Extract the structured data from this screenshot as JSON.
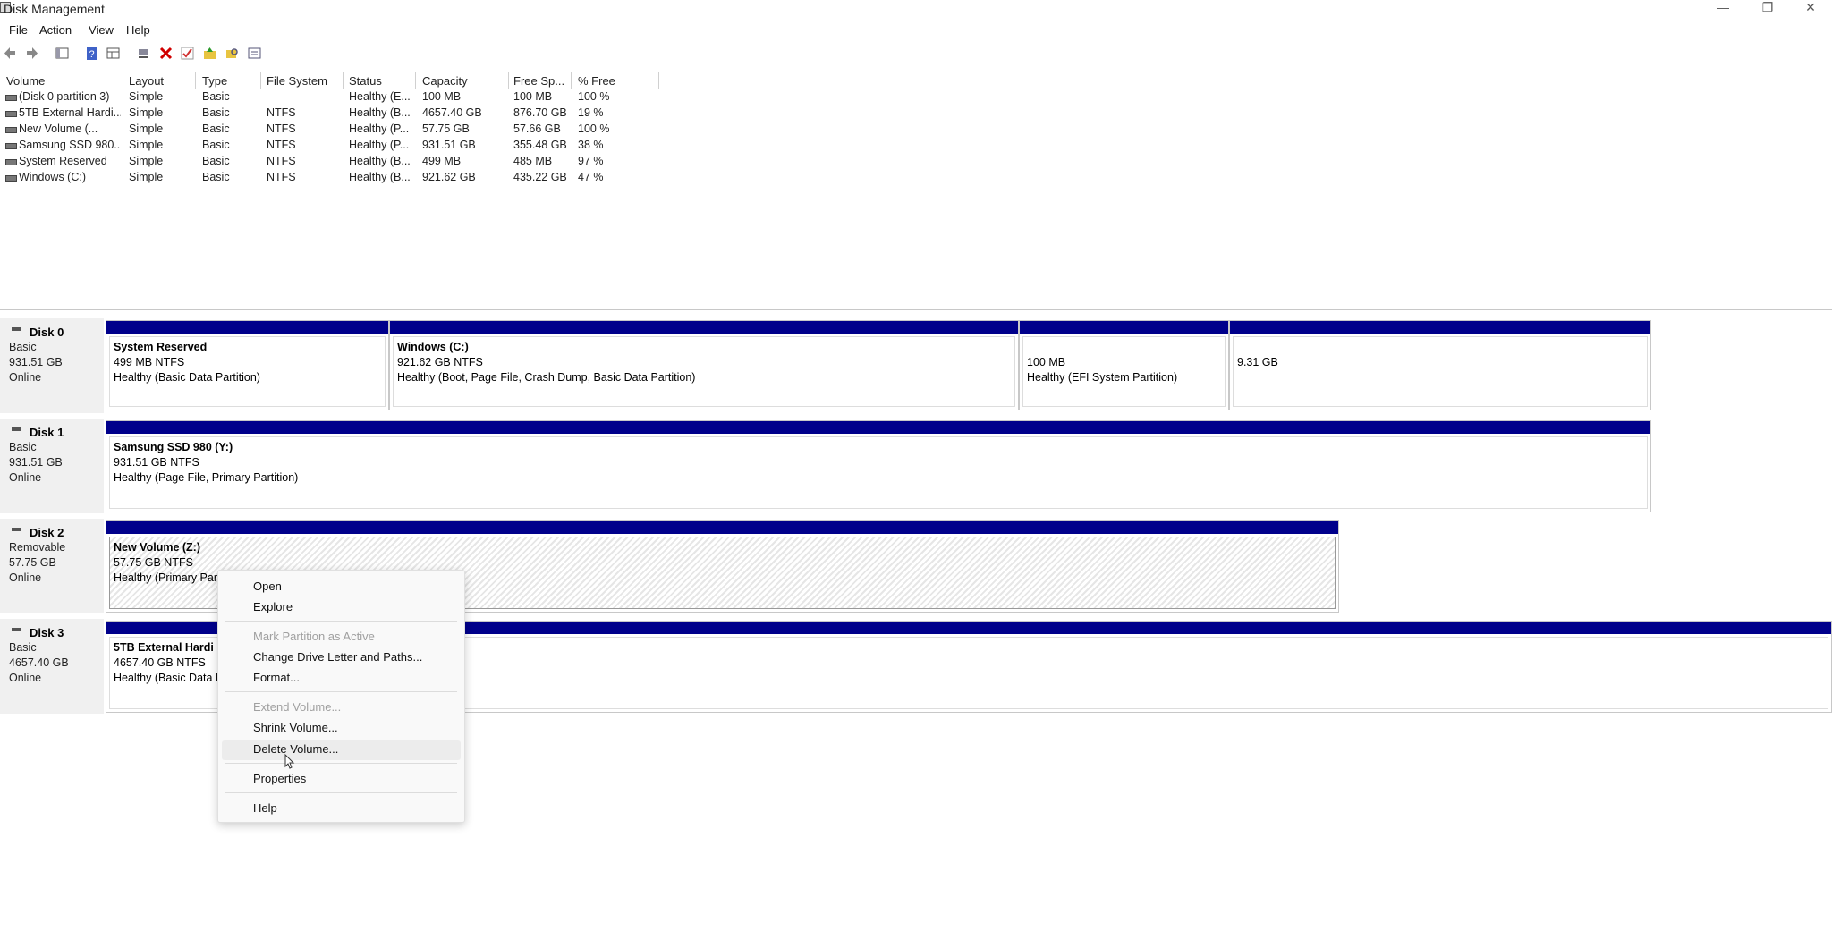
{
  "window": {
    "title": "Disk Management",
    "controls": [
      "—",
      "❐",
      "✕"
    ]
  },
  "menu": [
    "File",
    "Action",
    "View",
    "Help"
  ],
  "toolbar": {
    "icons": [
      "back-arrow-icon",
      "forward-arrow-icon",
      "console-tree-icon",
      "help-icon",
      "show-panel-icon",
      "connect-icon",
      "delete-icon",
      "checkmark-icon",
      "folder-up-icon",
      "folder-search-icon",
      "properties-list-icon"
    ],
    "delete_color": "#d00000"
  },
  "volume_table": {
    "headers": [
      "Volume",
      "Layout",
      "Type",
      "File System",
      "Status",
      "Capacity",
      "Free Sp...",
      "% Free"
    ],
    "rows": [
      {
        "volume": "(Disk 0 partition 3)",
        "layout": "Simple",
        "type": "Basic",
        "fs": "",
        "status": "Healthy (E...",
        "capacity": "100 MB",
        "free": "100 MB",
        "pct": "100 %"
      },
      {
        "volume": "5TB External Hardi...",
        "layout": "Simple",
        "type": "Basic",
        "fs": "NTFS",
        "status": "Healthy (B...",
        "capacity": "4657.40 GB",
        "free": "876.70 GB",
        "pct": "19 %"
      },
      {
        "volume": "New Volume (...",
        "layout": "Simple",
        "type": "Basic",
        "fs": "NTFS",
        "status": "Healthy (P...",
        "capacity": "57.75 GB",
        "free": "57.66 GB",
        "pct": "100 %"
      },
      {
        "volume": "Samsung SSD 980...",
        "layout": "Simple",
        "type": "Basic",
        "fs": "NTFS",
        "status": "Healthy (P...",
        "capacity": "931.51 GB",
        "free": "355.48 GB",
        "pct": "38 %"
      },
      {
        "volume": "System Reserved",
        "layout": "Simple",
        "type": "Basic",
        "fs": "NTFS",
        "status": "Healthy (B...",
        "capacity": "499 MB",
        "free": "485 MB",
        "pct": "97 %"
      },
      {
        "volume": "Windows (C:)",
        "layout": "Simple",
        "type": "Basic",
        "fs": "NTFS",
        "status": "Healthy (B...",
        "capacity": "921.62 GB",
        "free": "435.22 GB",
        "pct": "47 %"
      }
    ]
  },
  "disks": [
    {
      "name": "Disk 0",
      "type": "Basic",
      "size": "931.51 GB",
      "status": "Online",
      "partitions": [
        {
          "name": "System Reserved",
          "line1": "499 MB NTFS",
          "line2": "Healthy (Basic Data Partition)"
        },
        {
          "name": "Windows  (C:)",
          "line1": "921.62 GB NTFS",
          "line2": "Healthy (Boot, Page File, Crash Dump, Basic Data Partition)"
        },
        {
          "name": "",
          "line1": "100 MB",
          "line2": "Healthy (EFI System Partition)"
        },
        {
          "name": "",
          "line1": "9.31 GB",
          "line2": ""
        }
      ]
    },
    {
      "name": "Disk 1",
      "type": "Basic",
      "size": "931.51 GB",
      "status": "Online",
      "partitions": [
        {
          "name": "Samsung SSD 980  (Y:)",
          "line1": "931.51 GB NTFS",
          "line2": "Healthy (Page File, Primary Partition)"
        }
      ]
    },
    {
      "name": "Disk 2",
      "type": "Removable",
      "size": "57.75 GB",
      "status": "Online",
      "partitions": [
        {
          "name": "New Volume  (Z:)",
          "line1": "57.75 GB NTFS",
          "line2": "Healthy (Primary Par"
        }
      ]
    },
    {
      "name": "Disk 3",
      "type": "Basic",
      "size": "4657.40 GB",
      "status": "Online",
      "partitions": [
        {
          "name": "5TB External Hardi",
          "line1": "4657.40 GB NTFS",
          "line2": "Healthy (Basic Data I"
        }
      ]
    }
  ],
  "context_menu": {
    "items": [
      {
        "label": "Open",
        "enabled": true
      },
      {
        "label": "Explore",
        "enabled": true
      },
      {
        "label": "Mark Partition as Active",
        "enabled": false
      },
      {
        "label": "Change Drive Letter and Paths...",
        "enabled": true
      },
      {
        "label": "Format...",
        "enabled": true
      },
      {
        "label": "Extend Volume...",
        "enabled": false
      },
      {
        "label": "Shrink Volume...",
        "enabled": true
      },
      {
        "label": "Delete Volume...",
        "enabled": true
      },
      {
        "label": "Properties",
        "enabled": true
      },
      {
        "label": "Help",
        "enabled": true
      }
    ]
  },
  "colors": {
    "partition_bar": "#00008b",
    "panel_bg": "#f0f0f0"
  }
}
